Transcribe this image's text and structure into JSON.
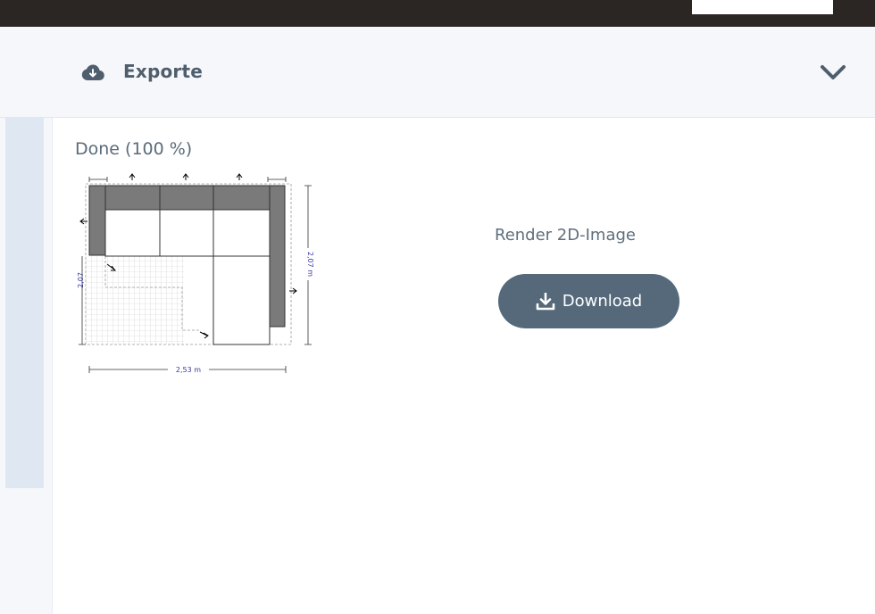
{
  "header": {
    "title": "Exporte",
    "icon": "cloud-download-icon",
    "toggle_icon": "chevron-down-icon"
  },
  "export": {
    "status": "Done (100 %)",
    "render_title": "Render 2D-Image",
    "download_label": "Download",
    "download_icon": "download-icon"
  },
  "floorplan": {
    "width_label": "2,53 m",
    "height_label_right": "2,07 m",
    "height_label_left": "2,07"
  },
  "colors": {
    "button": "#55697b",
    "header_bg": "#f5f7fa",
    "rail": "#dfe8f2",
    "text": "#5b6b7a",
    "dimension_text": "#3a3aa0"
  }
}
